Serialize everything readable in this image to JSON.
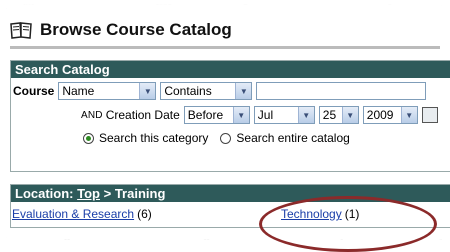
{
  "header": {
    "title": "Browse Course Catalog",
    "icon": "book-icon"
  },
  "search": {
    "bar_title": "Search Catalog",
    "course_label": "Course",
    "field_select": "Name",
    "operator_select": "Contains",
    "query_value": "",
    "and_label": "AND",
    "creation_date_label": "Creation Date",
    "date_op": "Before",
    "month": "Jul",
    "day": "25",
    "year": "2009",
    "radio_category": "Search this category",
    "radio_catalog": "Search entire catalog",
    "selected_scope": "category"
  },
  "location": {
    "label": "Location:",
    "top_link": "Top",
    "separator": ">",
    "current": "Training",
    "items": [
      {
        "name": "Evaluation & Research",
        "count": "(6)"
      },
      {
        "name": "Technology",
        "count": "(1)"
      }
    ]
  },
  "colors": {
    "bar": "#2e5a5a",
    "link": "#1a3ea8",
    "highlight_oval": "#8b2a2a",
    "radio_selected": "#2e8b22"
  }
}
